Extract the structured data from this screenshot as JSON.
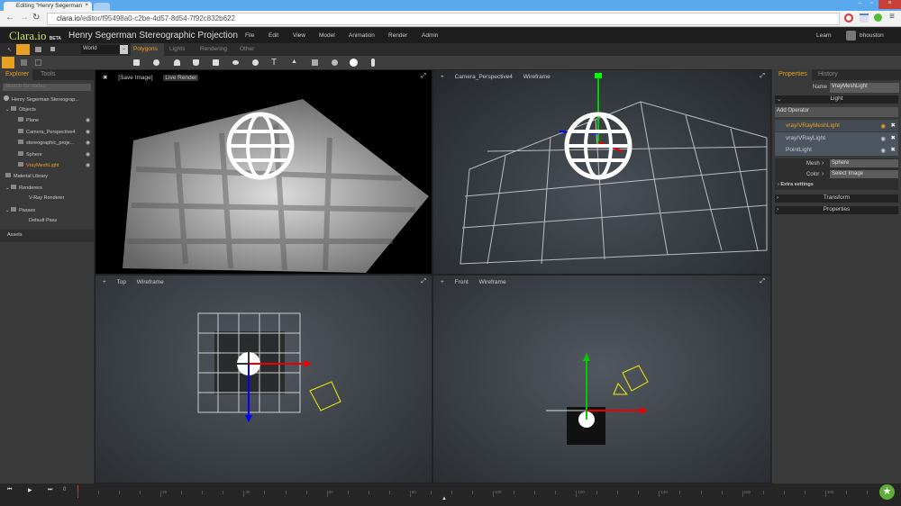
{
  "browser": {
    "tab_title": "Editing \"Henry Segerman",
    "url_host": "clara.io",
    "url_path": "/editor/f95498a0-c2be-4d57-8d54-7f92c832b622"
  },
  "app": {
    "logo": "Clara.io",
    "logo_badge": "BETA",
    "project_title": "Henry Segerman Stereographic Projection",
    "menu": [
      "File",
      "Edit",
      "View",
      "Model",
      "Animation",
      "Render",
      "Admin"
    ],
    "learn": "Learn",
    "user": "bhouston"
  },
  "toolbar": {
    "space_select": "World",
    "tabs": [
      "Polygons",
      "Lights",
      "Rendering",
      "Other"
    ],
    "active_tab": "Polygons",
    "accent": "#e8a020"
  },
  "explorer": {
    "tabs": [
      "Explorer",
      "Tools"
    ],
    "search_placeholder": "Search for nodes",
    "root": "Henry Segerman Stereograp...",
    "items": [
      {
        "label": "Objects",
        "level": 1,
        "expanded": true
      },
      {
        "label": "Plane",
        "level": 2,
        "eye": true
      },
      {
        "label": "Camera_Perspective4",
        "level": 2,
        "eye": true
      },
      {
        "label": "stereographic_proje...",
        "level": 2,
        "eye": true
      },
      {
        "label": "Sphere",
        "level": 2,
        "eye": true
      },
      {
        "label": "VrayMeshLight",
        "level": 2,
        "eye": true,
        "selected": true
      },
      {
        "label": "Material Library",
        "level": 1
      },
      {
        "label": "Renderers",
        "level": 1,
        "expanded": true
      },
      {
        "label": "V-Ray Renderer",
        "level": 3
      },
      {
        "label": "Passes",
        "level": 1,
        "expanded": true
      },
      {
        "label": "Default Pass",
        "level": 3
      }
    ],
    "assets": "Assets"
  },
  "viewports": {
    "top_left": {
      "buttons": [
        "[Save Image]",
        "Live Render"
      ]
    },
    "top_right": {
      "camera": "Camera_Perspective4",
      "mode": "Wireframe"
    },
    "bottom_left": {
      "camera": "Top",
      "mode": "Wireframe"
    },
    "bottom_right": {
      "camera": "Front",
      "mode": "Wireframe"
    }
  },
  "properties": {
    "tabs": [
      "Properties",
      "History"
    ],
    "name_label": "Name",
    "name_value": "VrayMeshLight",
    "light_section": "Light",
    "add_operator": "Add Operator",
    "operators": [
      {
        "label": "vray/VRayMeshLight",
        "active": true
      },
      {
        "label": "vray/VRayLight"
      },
      {
        "label": "PointLight"
      }
    ],
    "mesh_label": "Mesh",
    "mesh_value": "Sphere",
    "color_label": "Color",
    "color_value": "Select Image",
    "extra_settings": "Extra settings",
    "transform": "Transform",
    "properties_section": "Properties"
  },
  "timeline": {
    "current_frame": "0",
    "labels": [
      "20",
      "40",
      "60",
      "80",
      "100",
      "120",
      "140",
      "160",
      "180"
    ]
  }
}
